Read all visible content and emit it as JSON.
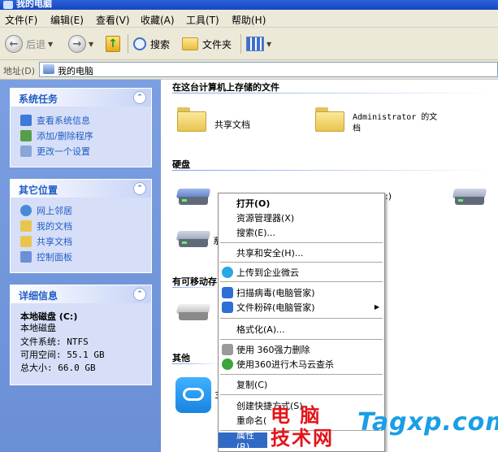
{
  "window": {
    "title": "我的电脑"
  },
  "menubar": [
    {
      "label": "文件(F)"
    },
    {
      "label": "编辑(E)"
    },
    {
      "label": "查看(V)"
    },
    {
      "label": "收藏(A)"
    },
    {
      "label": "工具(T)"
    },
    {
      "label": "帮助(H)"
    }
  ],
  "toolbar": {
    "back": "后退",
    "search": "搜索",
    "folders": "文件夹"
  },
  "address": {
    "label": "地址(D)",
    "value": "我的电脑"
  },
  "left": {
    "system_tasks": {
      "title": "系统任务",
      "items": [
        "查看系统信息",
        "添加/删除程序",
        "更改一个设置"
      ]
    },
    "other_places": {
      "title": "其它位置",
      "items": [
        "网上邻居",
        "我的文档",
        "共享文档",
        "控制面板"
      ]
    },
    "details": {
      "title": "详细信息",
      "name": "本地磁盘  (C:)",
      "type": "本地磁盘",
      "filesystem": "文件系统: NTFS",
      "free": "可用空间: 55.1 GB",
      "total": "总大小: 66.0 GB"
    }
  },
  "right": {
    "stored_files": {
      "header": "在这台计算机上存储的文件",
      "items": [
        "共享文档",
        "Administrator 的文档"
      ]
    },
    "hard_disks": {
      "header": "硬盘",
      "partial": ":)",
      "partial2": "系"
    },
    "removable": {
      "header": "有可移动存"
    },
    "other": {
      "header": "其他",
      "partial": "3"
    }
  },
  "context_menu": {
    "items": [
      "打开(O)",
      "资源管理器(X)",
      "搜索(E)...",
      "共享和安全(H)...",
      "上传到企业微云",
      "扫描病毒(电脑管家)",
      "文件粉碎(电脑管家)",
      "格式化(A)...",
      "使用 360强力删除",
      "使用360进行木马云查杀",
      "复制(C)",
      "创建快捷方式(S)",
      "重命名(",
      "属性(R)"
    ]
  },
  "watermark": {
    "line1": "电 脑",
    "line2": "技术网",
    "site": "Tagxp.com"
  },
  "colors": {
    "task_blue": "#215dc6",
    "pane_bg": "#7b9fe0",
    "highlight": "#316ac5",
    "watermark_red": "#e3141a",
    "watermark_blue": "#1a9ee6"
  }
}
